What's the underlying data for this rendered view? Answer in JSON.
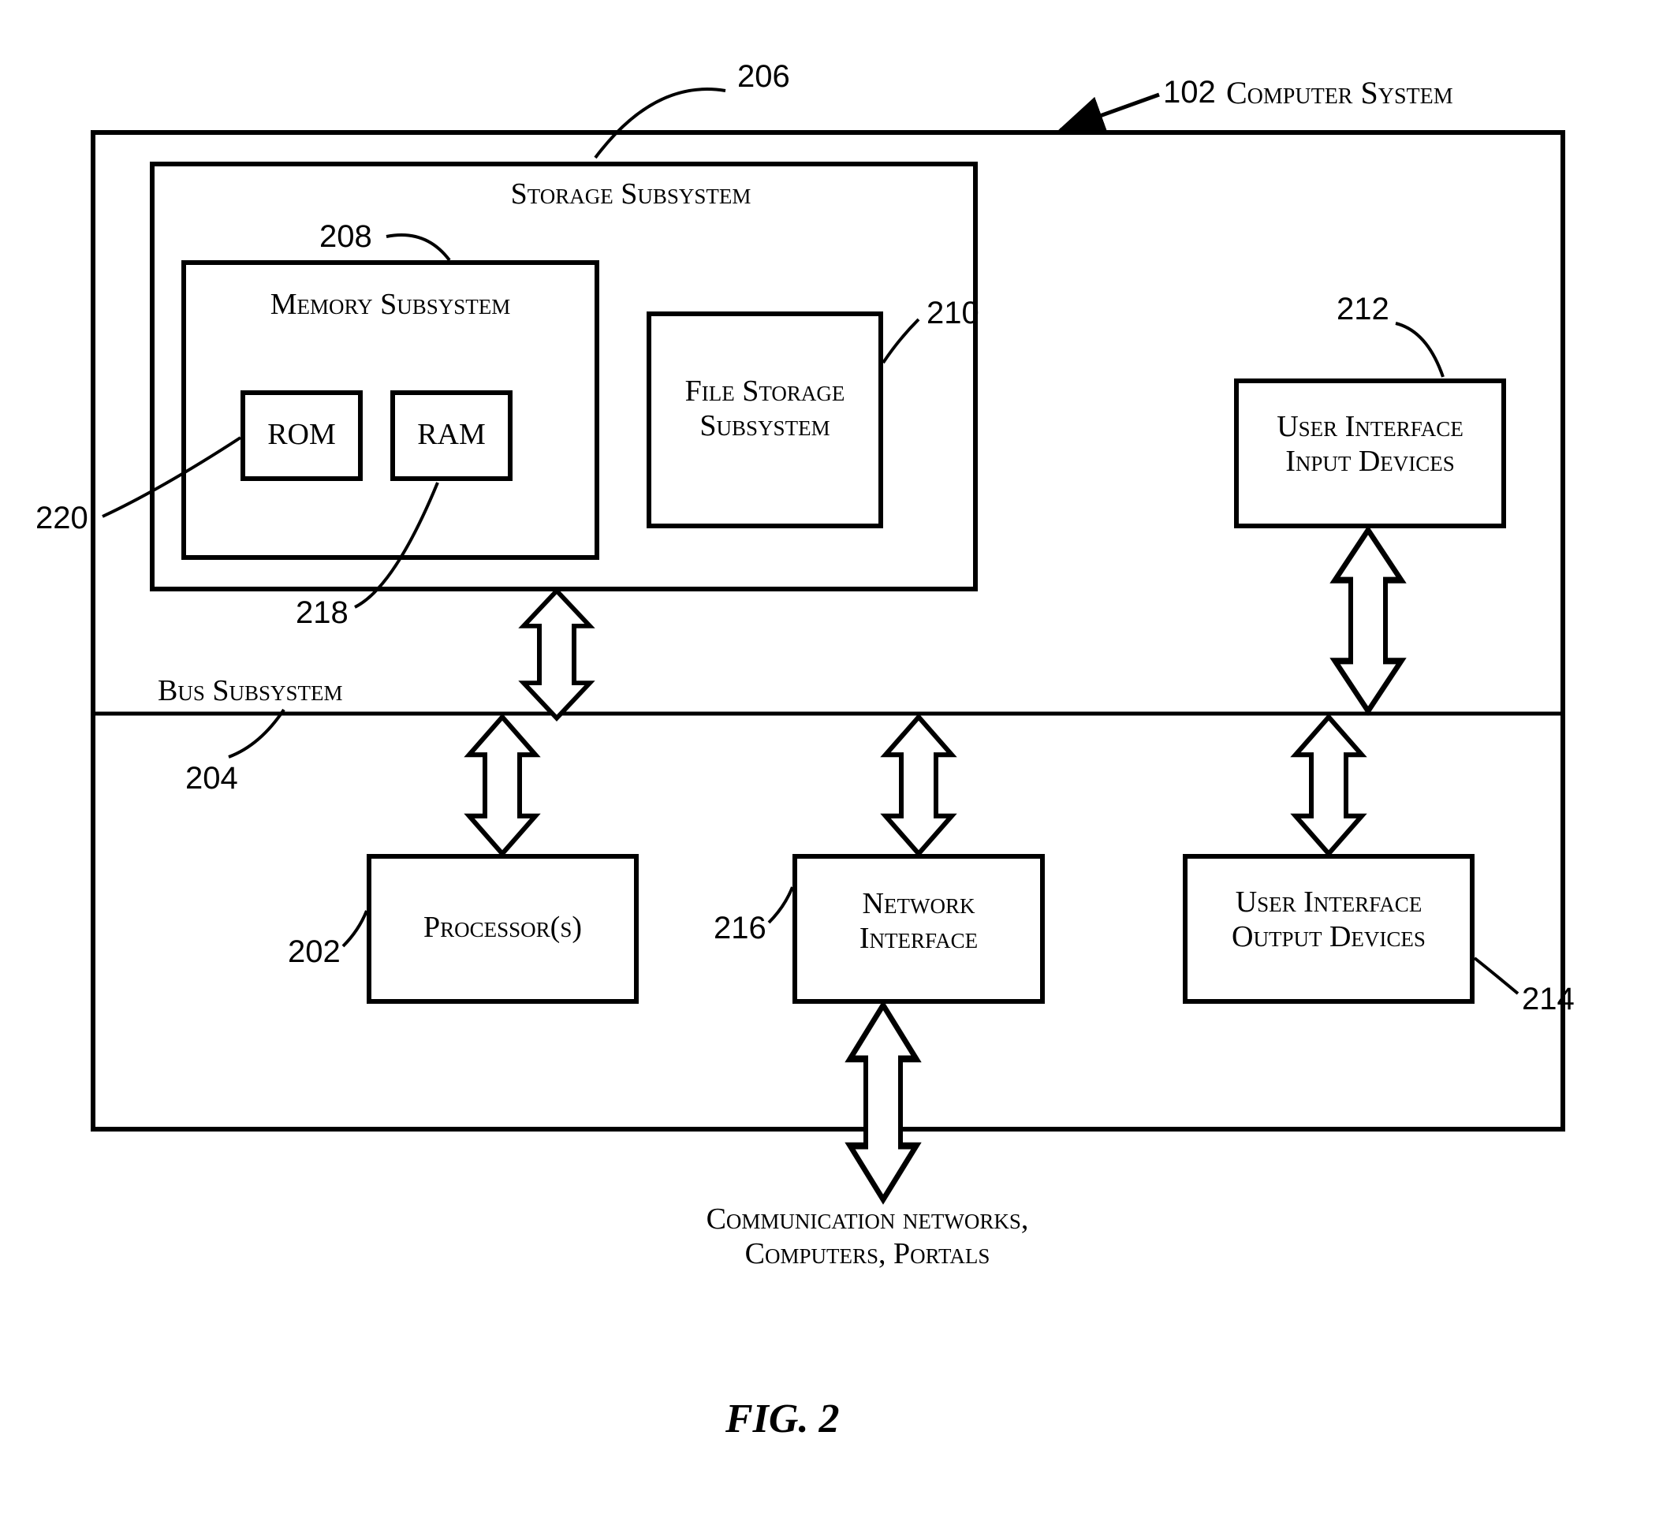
{
  "title_ref": "102",
  "title_text": "Computer System",
  "storage_subsystem": {
    "ref": "206",
    "label": "Storage Subsystem"
  },
  "memory_subsystem": {
    "ref": "208",
    "label": "Memory Subsystem"
  },
  "rom": {
    "ref": "220",
    "label": "ROM"
  },
  "ram": {
    "ref": "218",
    "label": "RAM"
  },
  "file_storage": {
    "ref": "210",
    "label": "File Storage\nSubsystem"
  },
  "ui_input": {
    "ref": "212",
    "label": "User Interface\nInput Devices"
  },
  "bus_subsystem": {
    "ref": "204",
    "label": "Bus Subsystem"
  },
  "processor": {
    "ref": "202",
    "label": "Processor(s)"
  },
  "network_if": {
    "ref": "216",
    "label": "Network\nInterface"
  },
  "ui_output": {
    "ref": "214",
    "label": "User Interface\nOutput Devices"
  },
  "comm_label": "Communication networks,\nComputers, Portals",
  "figure": "FIG. 2"
}
